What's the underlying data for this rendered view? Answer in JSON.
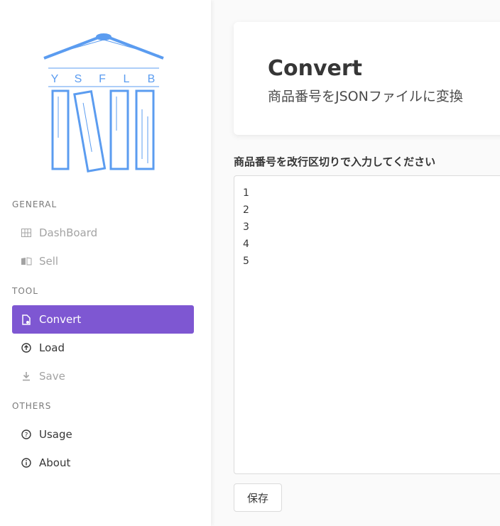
{
  "logo": {
    "letters": [
      "Y",
      "S",
      "F",
      "L",
      "B"
    ],
    "color": "#5b9cf0"
  },
  "sidebar": {
    "sections": [
      {
        "label": "GENERAL",
        "items": [
          {
            "label": "DashBoard",
            "icon": "dashboard-icon",
            "state": "disabled"
          },
          {
            "label": "Sell",
            "icon": "sell-icon",
            "state": "disabled"
          }
        ]
      },
      {
        "label": "TOOL",
        "items": [
          {
            "label": "Convert",
            "icon": "file-icon",
            "state": "active"
          },
          {
            "label": "Load",
            "icon": "upload-circle-icon",
            "state": "normal"
          },
          {
            "label": "Save",
            "icon": "download-icon",
            "state": "disabled"
          }
        ]
      },
      {
        "label": "OTHERS",
        "items": [
          {
            "label": "Usage",
            "icon": "question-icon",
            "state": "normal"
          },
          {
            "label": "About",
            "icon": "info-icon",
            "state": "normal"
          }
        ]
      }
    ]
  },
  "colors": {
    "accent": "#7e57d2",
    "disabled_text": "#a3a3a3"
  },
  "hero": {
    "title": "Convert",
    "subtitle": "商品番号をJSONファイルに変換"
  },
  "form": {
    "label": "商品番号を改行区切りで入力してください",
    "value": "1\n2\n3\n4\n5",
    "save_label": "保存"
  }
}
